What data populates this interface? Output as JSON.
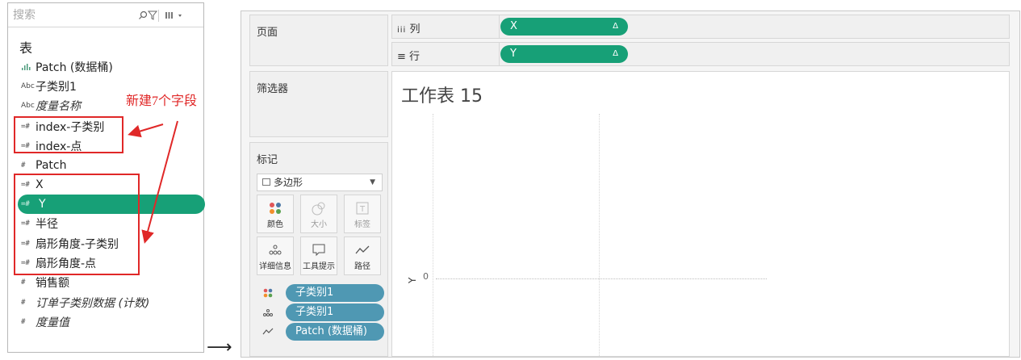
{
  "data_pane": {
    "search_placeholder": "搜索",
    "section_title": "表",
    "fields": [
      {
        "icon": "bin-icon",
        "label": "Patch (数据桶)"
      },
      {
        "icon": "abc-icon",
        "icon_text": "Abc",
        "label": "子类别1"
      },
      {
        "icon": "abc-icon",
        "icon_text": "Abc",
        "label": "度量名称"
      },
      {
        "icon": "calc-measure-icon",
        "icon_text": "=#",
        "label": "index-子类别"
      },
      {
        "icon": "calc-measure-icon",
        "icon_text": "=#",
        "label": "index-点"
      },
      {
        "icon": "measure-icon",
        "icon_text": "#",
        "label": "Patch"
      },
      {
        "icon": "calc-measure-icon",
        "icon_text": "=#",
        "label": "X"
      },
      {
        "icon": "calc-measure-icon",
        "icon_text": "=#",
        "label": "Y"
      },
      {
        "icon": "calc-measure-icon",
        "icon_text": "=#",
        "label": "半径"
      },
      {
        "icon": "calc-measure-icon",
        "icon_text": "=#",
        "label": "扇形角度-子类别"
      },
      {
        "icon": "calc-measure-icon",
        "icon_text": "=#",
        "label": "扇形角度-点"
      },
      {
        "icon": "measure-icon",
        "icon_text": "#",
        "label": "销售额"
      },
      {
        "icon": "measure-icon",
        "icon_text": "#",
        "label": "订单子类别数据 (计数)"
      },
      {
        "icon": "measure-icon",
        "icon_text": "#",
        "label": "度量值"
      }
    ],
    "annotation_text": "新建7个字段",
    "annotation_color": "#e02828",
    "selected_color": "#17a077"
  },
  "arrow_glyph": "⟶",
  "worksheet": {
    "pages_label": "页面",
    "filters_label": "筛选器",
    "columns_label": "列",
    "rows_label": "行",
    "column_pill": "X",
    "row_pill": "Y",
    "pill_delta": "Δ",
    "sheet_title": "工作表 15",
    "y_axis_label": "Y",
    "y_axis_tick": "0",
    "marks": {
      "title": "标记",
      "mark_type": "多边形",
      "buttons": [
        {
          "label": "颜色",
          "enabled": true
        },
        {
          "label": "大小",
          "enabled": false
        },
        {
          "label": "标签",
          "enabled": false
        },
        {
          "label": "详细信息",
          "enabled": true
        },
        {
          "label": "工具提示",
          "enabled": true
        },
        {
          "label": "路径",
          "enabled": true
        }
      ],
      "pills": [
        {
          "icon": "color-dots-icon",
          "label": "子类别1"
        },
        {
          "icon": "detail-dots-icon",
          "label": "子类别1"
        },
        {
          "icon": "path-icon",
          "label": "Patch (数据桶)"
        }
      ]
    }
  }
}
